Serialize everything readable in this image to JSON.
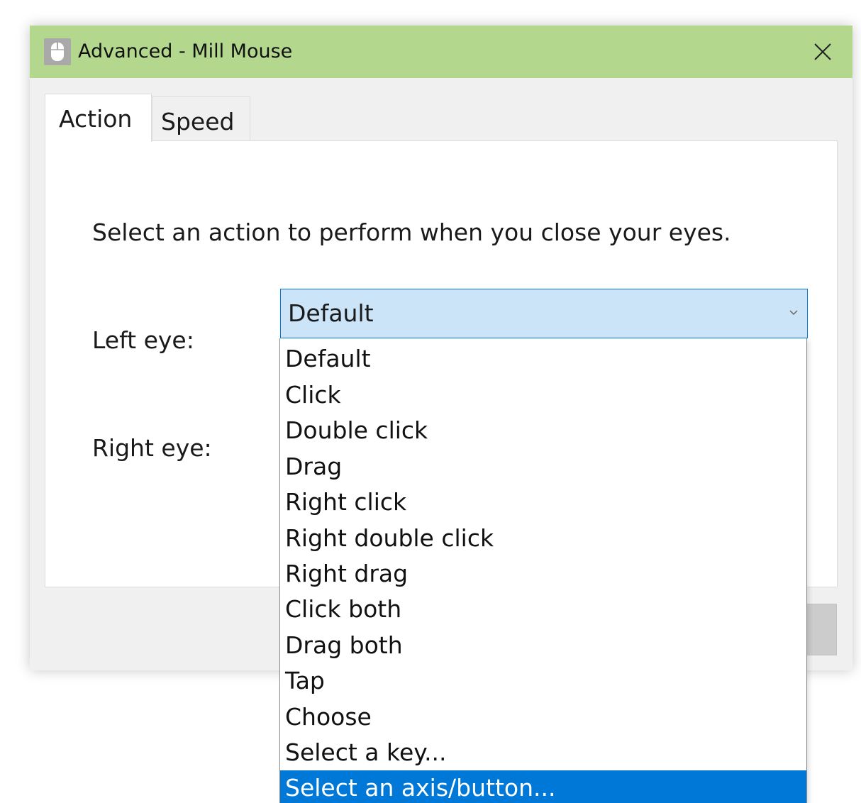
{
  "window": {
    "title": "Advanced - Mill Mouse",
    "titlebar_color": "#b2d78d",
    "app_icon": "mouse-icon",
    "close_icon": "close-icon"
  },
  "tabs": [
    {
      "label": "Action",
      "active": true
    },
    {
      "label": "Speed",
      "active": false
    }
  ],
  "panel": {
    "instruction": "Select an action to perform when you close your eyes.",
    "left_eye": {
      "label": "Left eye:",
      "selected_value": "Default"
    },
    "right_eye": {
      "label": "Right eye:"
    }
  },
  "dropdown": {
    "open_for": "left_eye",
    "options": [
      "Default",
      "Click",
      "Double click",
      "Drag",
      "Right click",
      "Right double click",
      "Right drag",
      "Click both",
      "Drag both",
      "Tap",
      "Choose",
      "Select a key...",
      "Select an axis/button..."
    ],
    "highlighted": "Select an axis/button...",
    "highlight_color": "#0078d7"
  }
}
